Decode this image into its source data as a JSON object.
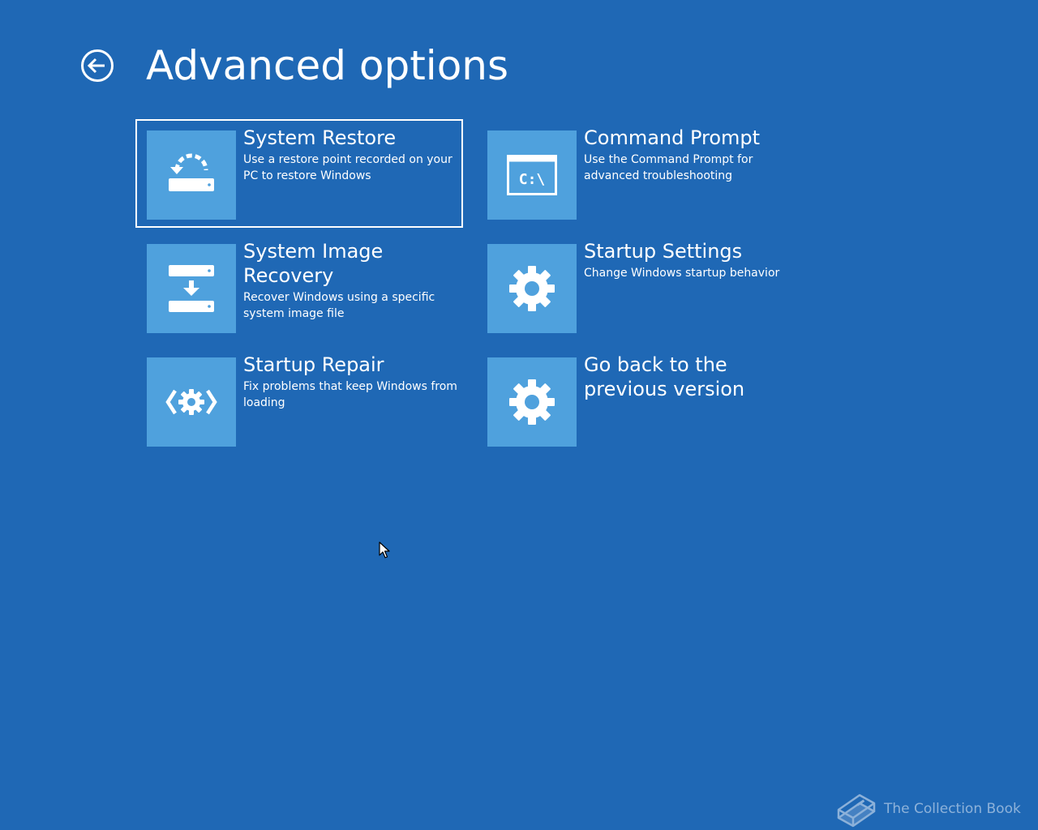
{
  "header": {
    "title": "Advanced options",
    "back_icon": "back-arrow-circle-icon"
  },
  "options": [
    {
      "label": "System Restore",
      "description": "Use a restore point recorded on your PC to restore Windows",
      "icon": "system-restore-icon",
      "selected": true
    },
    {
      "label": "Command Prompt",
      "description": "Use the Command Prompt for advanced troubleshooting",
      "icon": "command-prompt-icon",
      "icon_text": "C:\\"
    },
    {
      "label": "System Image Recovery",
      "description": "Recover Windows using a specific system image file",
      "icon": "system-image-recovery-icon"
    },
    {
      "label": "Startup Settings",
      "description": "Change Windows startup behavior",
      "icon": "gear-icon"
    },
    {
      "label": "Startup Repair",
      "description": "Fix problems that keep Windows from loading",
      "icon": "startup-repair-icon"
    },
    {
      "label": "Go back to the previous version",
      "description": "",
      "icon": "gear-icon"
    }
  ],
  "watermark": {
    "text": "The Collection Book",
    "icon": "book-icon"
  },
  "colors": {
    "background": "#1f68b5",
    "tile": "#4fa1dd",
    "text": "#ffffff"
  }
}
